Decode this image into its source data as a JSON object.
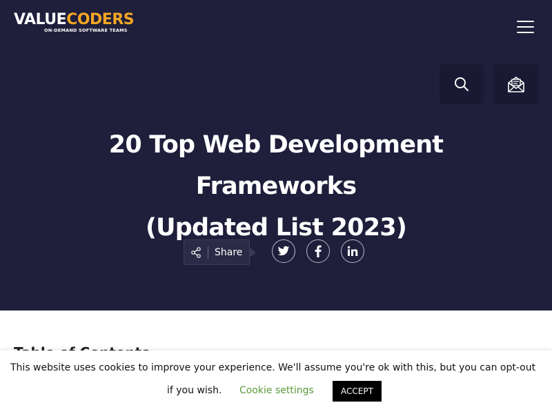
{
  "header": {
    "logo": {
      "part1": "VALUE",
      "part2": "CODERS",
      "tagline": "ON-DEMAND SOFTWARE TEAMS"
    },
    "menu_icon": "hamburger-icon",
    "search_icon": "search-icon",
    "contact_icon": "envelope-icon"
  },
  "hero": {
    "title_line1": "20 Top Web Development Frameworks",
    "title_line2": "(Updated List 2023)",
    "share_label": "Share",
    "social_icons": [
      "twitter-icon",
      "facebook-icon",
      "linkedin-icon"
    ]
  },
  "content": {
    "toc_heading": "Table of Contents"
  },
  "cookie": {
    "message_line1": "This website uses cookies to improve your experience. We'll assume you're ok with this, but you can opt-out",
    "message_line2": "if you wish.",
    "settings_label": "Cookie settings",
    "accept_label": "ACCEPT"
  },
  "colors": {
    "hero_bg": "#1f1e3b",
    "logo_accent": "#f5a623",
    "cookie_link": "#5a9a3a",
    "accept_bg": "#000000"
  }
}
